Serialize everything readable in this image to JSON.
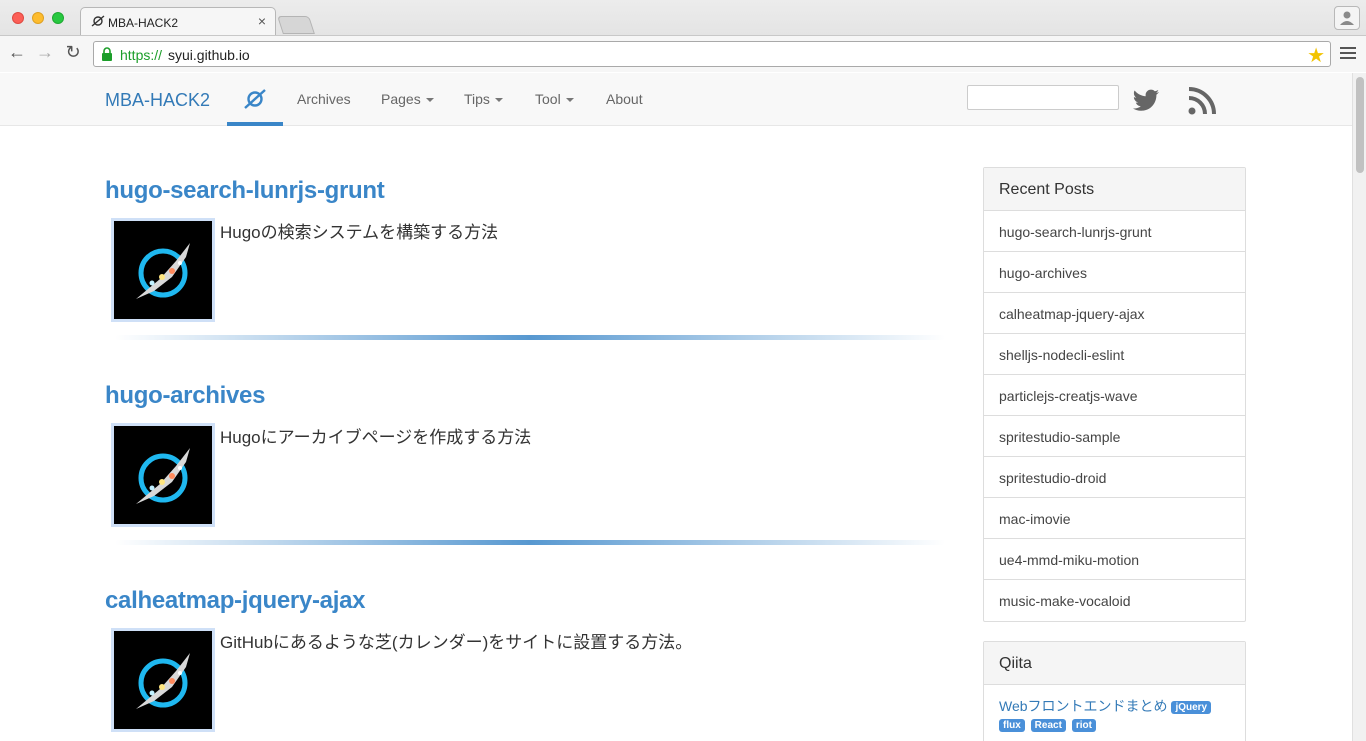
{
  "browser": {
    "tab_title": "MBA-HACK2",
    "tab_close": "×",
    "url_scheme": "https://",
    "url_host": "syui.github.io"
  },
  "navbar": {
    "brand": "MBA-HACK2",
    "items": [
      {
        "label": "Archives",
        "dropdown": false
      },
      {
        "label": "Pages",
        "dropdown": true
      },
      {
        "label": "Tips",
        "dropdown": true
      },
      {
        "label": "Tool",
        "dropdown": true
      },
      {
        "label": "About",
        "dropdown": false
      }
    ],
    "search_value": ""
  },
  "posts": [
    {
      "title": "hugo-search-lunrjs-grunt",
      "desc": "Hugoの検索システムを構築する方法"
    },
    {
      "title": "hugo-archives",
      "desc": "Hugoにアーカイブページを作成する方法"
    },
    {
      "title": "calheatmap-jquery-ajax",
      "desc": "GitHubにあるような芝(カレンダー)をサイトに設置する方法。"
    }
  ],
  "sidebar": {
    "recent_title": "Recent Posts",
    "recent": [
      "hugo-search-lunrjs-grunt",
      "hugo-archives",
      "calheatmap-jquery-ajax",
      "shelljs-nodecli-eslint",
      "particlejs-creatjs-wave",
      "spritestudio-sample",
      "spritestudio-droid",
      "mac-imovie",
      "ue4-mmd-miku-motion",
      "music-make-vocaloid"
    ],
    "qiita_title": "Qiita",
    "qiita_link": "Webフロントエンドまとめ",
    "qiita_tags": [
      "jQuery",
      "flux",
      "React",
      "riot"
    ]
  },
  "colors": {
    "link": "#337ab7",
    "post_title": "#3a86c8",
    "url_scheme": "#1c9e2a",
    "tag": "#4a90d9"
  },
  "icons": [
    "twitter-icon",
    "rss-icon",
    "planet-logo-icon",
    "lock-icon",
    "star-icon",
    "back-icon",
    "forward-icon",
    "reload-icon",
    "menu-icon",
    "profile-icon"
  ]
}
